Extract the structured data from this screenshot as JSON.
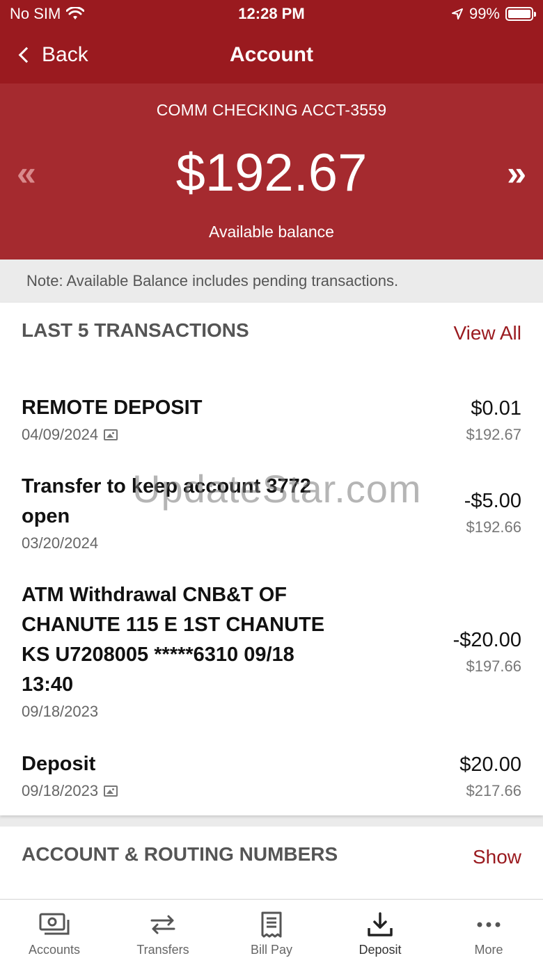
{
  "status_bar": {
    "carrier": "No SIM",
    "time": "12:28 PM",
    "battery": "99%",
    "battery_level": 0.99
  },
  "nav": {
    "back_label": "Back",
    "title": "Account"
  },
  "account": {
    "name": "COMM CHECKING ACCT-3559",
    "balance": "$192.67",
    "balance_label": "Available balance",
    "prev_glyph": "«",
    "next_glyph": "»"
  },
  "note": "Note: Available Balance includes pending transactions.",
  "transactions_section": {
    "title": "LAST 5 TRANSACTIONS",
    "view_all_label": "View All",
    "items": [
      {
        "description": "REMOTE DEPOSIT",
        "date": "04/09/2024",
        "has_image": true,
        "amount": "$0.01",
        "running_balance": "$192.67"
      },
      {
        "description": "Transfer to keep account 3772 open",
        "date": "03/20/2024",
        "has_image": false,
        "amount": "-$5.00",
        "running_balance": "$192.66"
      },
      {
        "description": "ATM Withdrawal CNB&T OF CHANUTE 115 E 1ST CHANUTE KS U7208005 *****6310 09/18 13:40",
        "date": "09/18/2023",
        "has_image": false,
        "amount": "-$20.00",
        "running_balance": "$197.66"
      },
      {
        "description": "Deposit",
        "date": "09/18/2023",
        "has_image": true,
        "amount": "$20.00",
        "running_balance": "$217.66"
      }
    ]
  },
  "routing_section": {
    "title": "ACCOUNT & ROUTING NUMBERS",
    "show_label": "Show"
  },
  "watermark": "UpdateStar.com",
  "tabs": [
    {
      "label": "Accounts",
      "icon": "accounts-icon"
    },
    {
      "label": "Transfers",
      "icon": "transfers-icon"
    },
    {
      "label": "Bill Pay",
      "icon": "bill-pay-icon"
    },
    {
      "label": "Deposit",
      "icon": "deposit-icon"
    },
    {
      "label": "More",
      "icon": "more-icon"
    }
  ],
  "colors": {
    "brand": "#9a1a1f",
    "panel": "#a52a2f",
    "link": "#9a1a1f"
  }
}
